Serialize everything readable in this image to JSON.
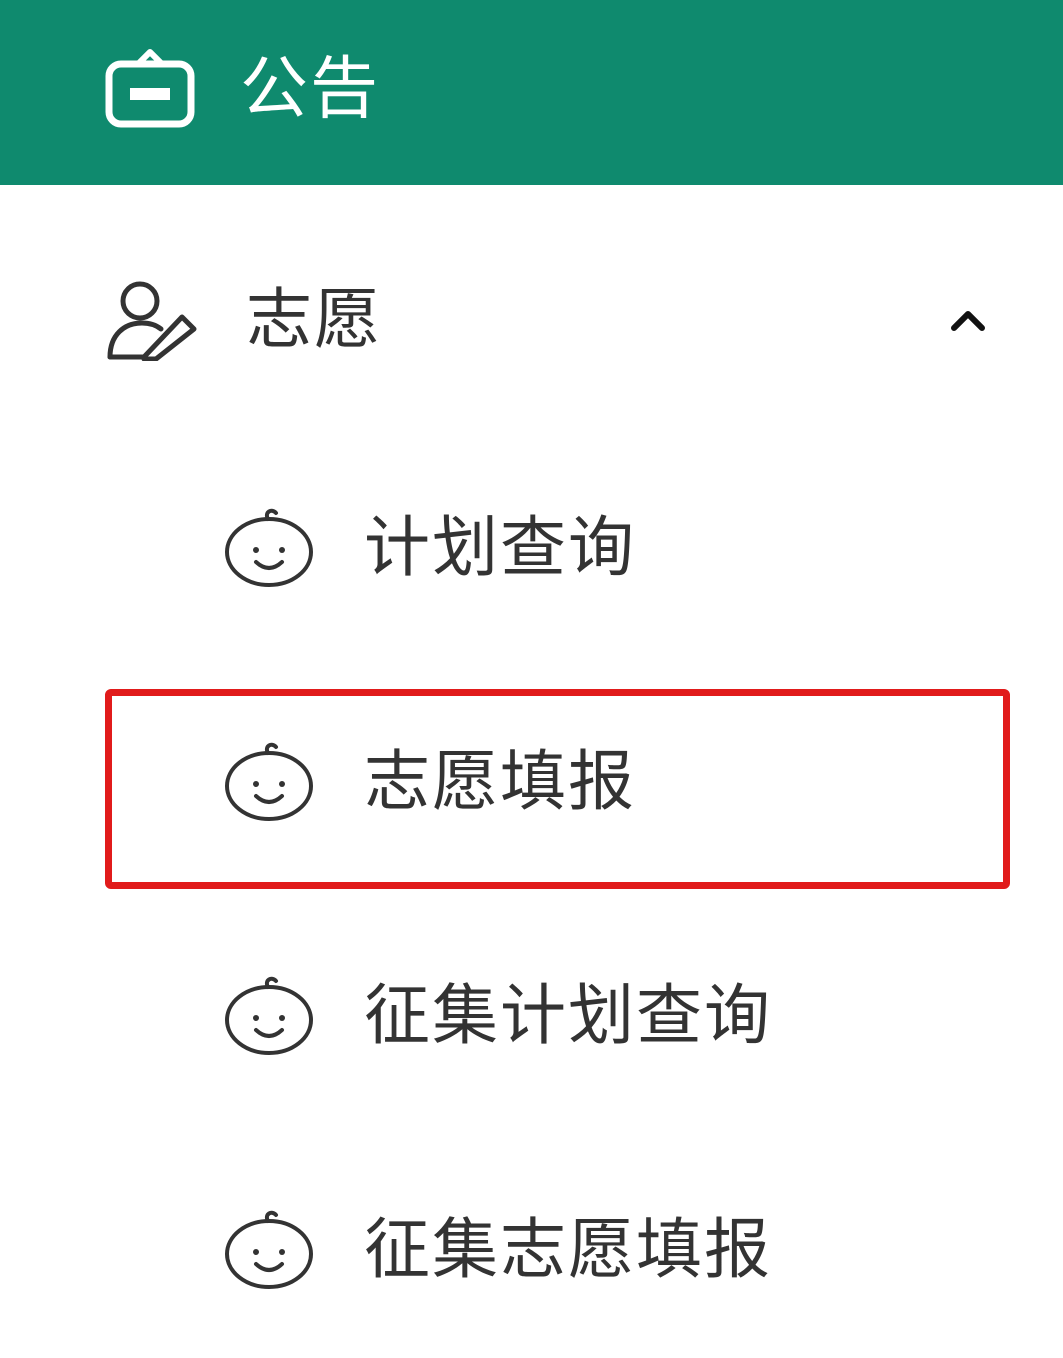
{
  "header": {
    "title": "公告",
    "icon": "notice-board-icon"
  },
  "menu": {
    "group_label": "志愿",
    "group_icon": "user-edit-icon",
    "expanded": true,
    "items": [
      {
        "label": "计划查询",
        "icon": "baby-face-icon"
      },
      {
        "label": "志愿填报",
        "icon": "baby-face-icon",
        "highlighted": true
      },
      {
        "label": "征集计划查询",
        "icon": "baby-face-icon"
      },
      {
        "label": "征集志愿填报",
        "icon": "baby-face-icon"
      }
    ]
  },
  "colors": {
    "header_bg": "#0f8a6e",
    "highlight_border": "#e11b1b",
    "text": "#333333"
  }
}
